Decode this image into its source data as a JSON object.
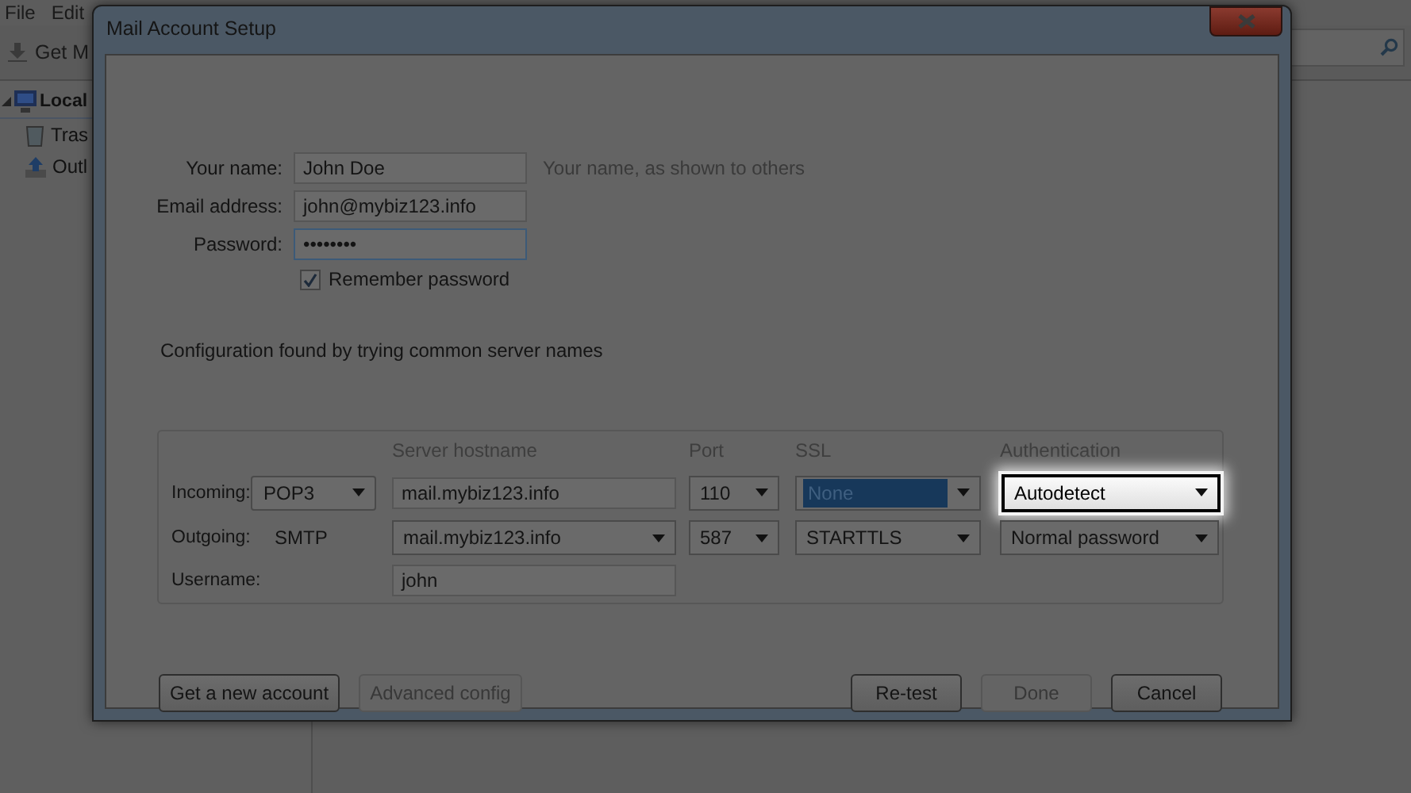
{
  "background_app": {
    "menu": [
      "File",
      "Edit"
    ],
    "toolbar_button": "Get M",
    "folders": [
      {
        "label": "Local",
        "expanded": true,
        "children": [
          {
            "label": "Tras"
          },
          {
            "label": "Outl"
          }
        ]
      }
    ]
  },
  "dialog": {
    "title": "Mail Account Setup",
    "fields": [
      {
        "label": "Your name:",
        "value": "John Doe",
        "hint": "Your name, as shown to others",
        "focused": false
      },
      {
        "label": "Email address:",
        "value": "john@mybiz123.info",
        "focused": false
      },
      {
        "label": "Password:",
        "value": "••••••••",
        "focused": true
      }
    ],
    "remember_password": {
      "label": "Remember password",
      "checked": true
    },
    "status": "Configuration found by trying common server names",
    "server_table": {
      "columns": [
        "Server hostname",
        "Port",
        "SSL",
        "Authentication"
      ],
      "rows": [
        {
          "label": "Incoming:",
          "protocol": {
            "kind": "dropdown",
            "value": "POP3"
          },
          "hostname": {
            "kind": "text",
            "value": "mail.mybiz123.info"
          },
          "port": {
            "kind": "dropdown",
            "value": "110"
          },
          "ssl": {
            "kind": "dropdown",
            "value": "None",
            "selected": true,
            "highlighted": false
          },
          "auth": {
            "kind": "dropdown",
            "value": "Autodetect",
            "selected": false,
            "highlighted": true
          }
        },
        {
          "label": "Outgoing:",
          "protocol": {
            "kind": "label",
            "value": "SMTP"
          },
          "hostname": {
            "kind": "dropdown",
            "value": "mail.mybiz123.info"
          },
          "port": {
            "kind": "dropdown",
            "value": "587"
          },
          "ssl": {
            "kind": "dropdown",
            "value": "STARTTLS",
            "selected": false,
            "highlighted": false
          },
          "auth": {
            "kind": "dropdown",
            "value": "Normal password",
            "selected": false,
            "highlighted": false
          }
        },
        {
          "label": "Username:",
          "hostname": {
            "kind": "text",
            "value": "john"
          }
        }
      ]
    },
    "buttons_left": [
      {
        "label": "Get a new account",
        "disabled": false
      },
      {
        "label": "Advanced config",
        "disabled": true
      }
    ],
    "buttons_right": [
      {
        "label": "Re-test",
        "disabled": false
      },
      {
        "label": "Done",
        "disabled": true
      },
      {
        "label": "Cancel",
        "disabled": false
      }
    ]
  }
}
